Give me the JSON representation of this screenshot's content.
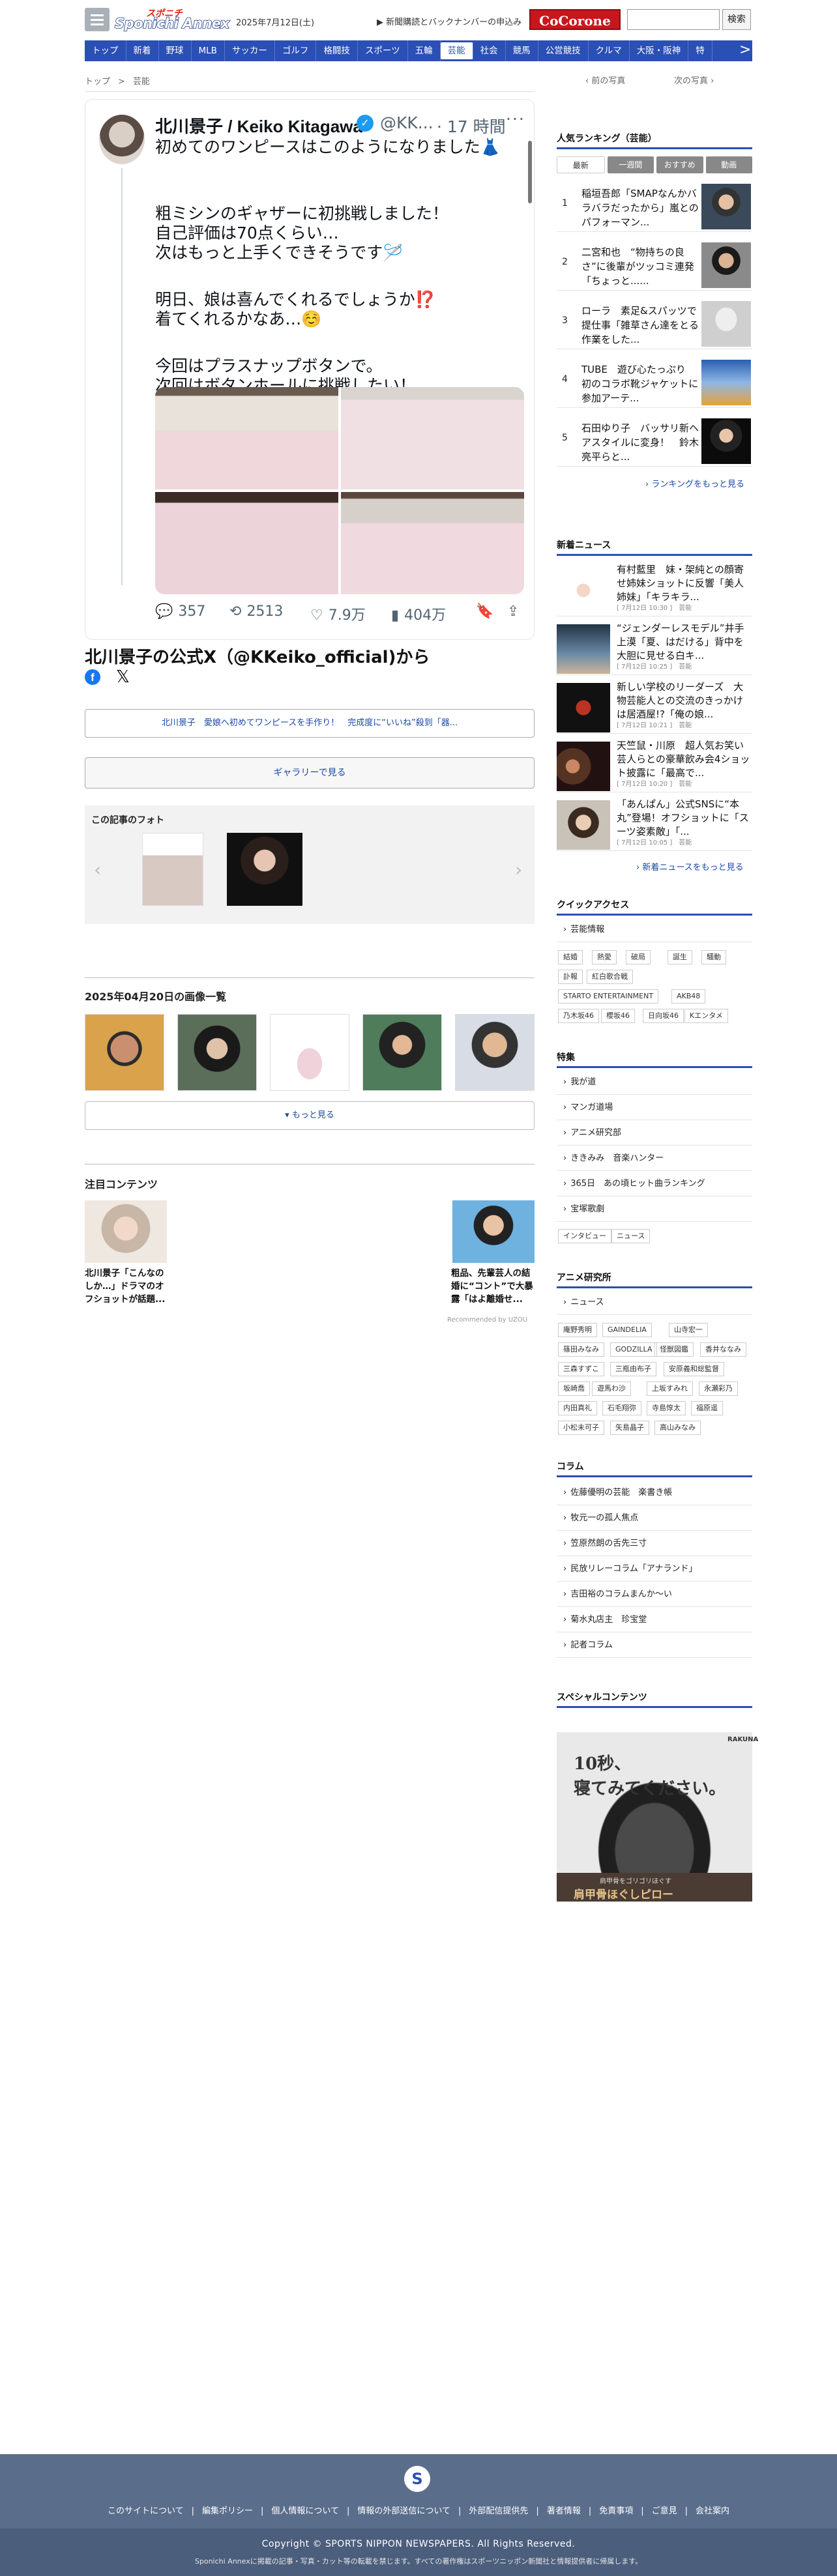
{
  "header": {
    "logo_top": "スポニチ",
    "logo_main": "Sponichi Annex",
    "date": "2025年7月12日(土)",
    "news_link": "▶ 新聞購読とバックナンバーの申込み",
    "cocorone": "CoCorone",
    "search_placeholder": "",
    "search_button": "検索"
  },
  "nav": {
    "items": [
      "トップ",
      "新着",
      "野球",
      "MLB",
      "サッカー",
      "ゴルフ",
      "格闘技",
      "スポーツ",
      "五輪",
      "芸能",
      "社会",
      "競馬",
      "公営競技",
      "クルマ",
      "大阪・阪神",
      "特"
    ],
    "active_index": 9,
    "more_icon": "chevron-right"
  },
  "breadcrumb": {
    "items": [
      "トップ",
      ">",
      "芸能"
    ],
    "prev": "‹ 前の写真",
    "next": "次の写真 ›"
  },
  "tweet": {
    "name": "北川景子 / Keiko Kitagawa",
    "handle": "@KK...",
    "time": "· 17 時間",
    "menu": "···",
    "lines": [
      "初めてのワンピースはこのようになりました👗",
      "",
      "粗ミシンのギャザーに初挑戦しました！",
      "自己評価は70点くらい…",
      "次はもっと上手くできそうです🪡",
      "",
      "明日、娘は喜んでくれるでしょうか⁉️",
      "着てくれるかなあ…☺️",
      "",
      "今回はプラスナップボタンで。",
      "次回はボタンホールに挑戦したい！"
    ],
    "actions": {
      "reply": "357",
      "retweet": "2513",
      "like": "7.9万",
      "views": "404万"
    }
  },
  "article": {
    "x_title": "北川景子の公式X（@KKeiko_official)から",
    "related_link": "北川景子　愛娘へ初めてワンピースを手作り！　完成度に“いいね”殺到「器...",
    "gallery_button": "ギャラリーで見る",
    "photos_title": "この記事のフォト",
    "images_title": "2025年04月20日の画像一覧",
    "more_button": "もっと見る",
    "attention_title": "注目コンテンツ",
    "attention": [
      {
        "text": "北川景子「こんなのしか…」ドラマのオフショットが話題..."
      },
      {
        "text": "粗品、先輩芸人の結婚に“コント”で大暴露「はよ離婚せ..."
      }
    ],
    "recommended": "Recommended by UZOU"
  },
  "sidebar": {
    "ranking_title": "人気ランキング（芸能）",
    "ranking_tabs": [
      "最新",
      "一週間",
      "おすすめ",
      "動画"
    ],
    "ranking": [
      {
        "num": "1",
        "text": "稲垣吾郎「SMAPなんかバラバラだったから」嵐とのパフォーマン..."
      },
      {
        "num": "2",
        "text": "二宮和也　“物持ちの良さ”に後輩がツッコミ連発「ちょっと......"
      },
      {
        "num": "3",
        "text": "ローラ　素足&スパッツで提仕事「雑草さん達をとる作業をした..."
      },
      {
        "num": "4",
        "text": "TUBE　遊び心たっぷり　初のコラボ靴ジャケットに参加アーテ..."
      },
      {
        "num": "5",
        "text": "石田ゆり子　バッサリ新ヘアスタイルに変身！　鈴木亮平らと..."
      }
    ],
    "ranking_more": "› ランキングをもっと見る",
    "news_title": "新着ニュース",
    "news": [
      {
        "text": "有村藍里　妹・架純との顔寄せ姉妹ショットに反響「美人姉妹」「キラキラ...",
        "meta": "[ 7月12日 10:30 ]　芸能"
      },
      {
        "text": "“ジェンダーレスモデル”井手上漠「夏、はだける」背中を大胆に見せる白キ...",
        "meta": "[ 7月12日 10:25 ]　芸能"
      },
      {
        "text": "新しい学校のリーダーズ　大物芸能人との交流のきっかけは居酒屋!?「俺の娘...",
        "meta": "[ 7月12日 10:21 ]　芸能"
      },
      {
        "text": "天竺鼠・川原　超人気お笑い芸人らとの豪華飲み会4ショット披露に「最高で...",
        "meta": "[ 7月12日 10:20 ]　芸能"
      },
      {
        "text": "「あんぱん」公式SNSに“本丸”登場！オフショットに「スーツ姿素敵」「...",
        "meta": "[ 7月12日 10:05 ]　芸能"
      }
    ],
    "news_more": "› 新着ニュースをもっと見る",
    "quick_title": "クイックアクセス",
    "quick_head": "芸能情報",
    "quick_tags": [
      "結婚",
      "熱愛",
      "破局",
      "誕生",
      "騒動",
      "訃報",
      "紅白歌合戦",
      "STARTO ENTERTAINMENT",
      "AKB48",
      "乃木坂46",
      "櫻坂46",
      "日向坂46",
      "Kエンタメ"
    ],
    "special_title": "特集",
    "special_items": [
      "我が道",
      "マンガ道場",
      "アニメ研究部",
      "ききみみ　音楽ハンター",
      "365日　あの頃ヒット曲ランキング",
      "宝塚歌劇"
    ],
    "special_tags": [
      "インタビュー",
      "ニュース"
    ],
    "anime_title": "アニメ研究所",
    "anime_head": "ニュース",
    "anime_tags": [
      "庵野秀明",
      "GAINDELIA",
      "山寺宏一",
      "篠田みなみ",
      "GODZILLA",
      "怪獣図鑑",
      "香井ななみ",
      "三森すずこ",
      "三瓶由布子",
      "安原義和総監督",
      "坂崎喬",
      "遊馬わ沙",
      "上坂すみれ",
      "永瀬彩乃",
      "内田真礼",
      "石毛翔弥",
      "寺島惇太",
      "福原遥",
      "小松未可子",
      "矢島晶子",
      "高山みなみ"
    ],
    "column_title": "コラム",
    "column_items": [
      "佐藤優明の芸能　楽書き帳",
      "牧元一の孤人焦点",
      "笠原然朗の舌先三寸",
      "民放リレーコラム「アナランド」",
      "吉田裕のコラムまんか〜い",
      "菊水丸店主　珍宝堂",
      "記者コラム"
    ],
    "special_contents_title": "スペシャルコンテンツ",
    "ad": {
      "line1": "10秒、",
      "line2": "寝てみてください。",
      "brand": "RAKUNA",
      "sub": "肩甲骨をゴリゴリほぐす",
      "foot": "肩甲骨ほぐしピロー"
    }
  },
  "footer": {
    "logo": "S",
    "links": [
      "このサイトについて",
      "|",
      "編集ポリシー",
      "|",
      "個人情報について",
      "|",
      "情報の外部送信について",
      "|",
      "外部配信提供先",
      "|",
      "著者情報",
      "|",
      "免責事項",
      "|",
      "ご意見",
      "|",
      "会社案内"
    ],
    "copyright": "Copyright © SPORTS NIPPON NEWSPAPERS. All Rights Reserved.",
    "note": "Sponichi Annexに掲載の記事・写真・カット等の転載を禁じます。すべての著作権はスポーツニッポン新聞社と情報提供者に帰属します。"
  }
}
